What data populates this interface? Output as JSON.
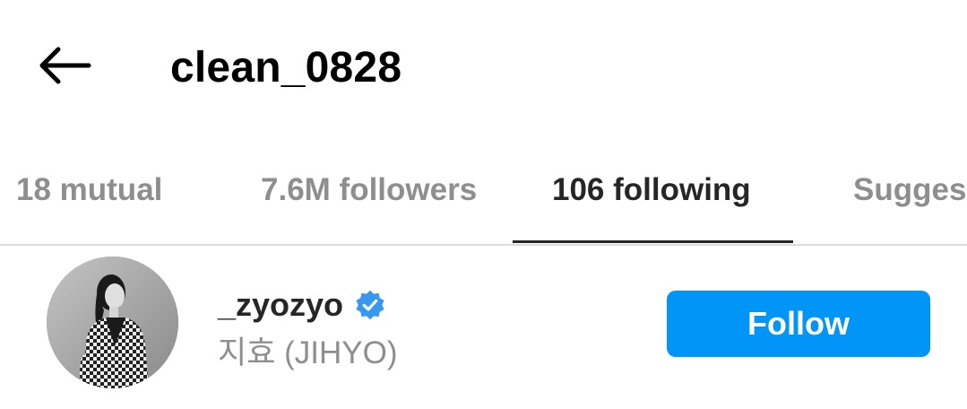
{
  "header": {
    "back_icon": "arrow-left-icon",
    "title": "clean_0828"
  },
  "tabs": [
    {
      "label": "18 mutual",
      "active": false
    },
    {
      "label": "7.6M followers",
      "active": false
    },
    {
      "label": "106 following",
      "active": true
    },
    {
      "label": "Suggested",
      "active": false
    }
  ],
  "list": [
    {
      "username": "_zyozyo",
      "verified": true,
      "verified_icon": "verified-badge-icon",
      "full_name": "지효 (JIHYO)",
      "avatar_icon": "profile-photo-avatar",
      "follow_label": "Follow"
    }
  ],
  "colors": {
    "accent": "#0095f6",
    "text_primary": "#262626",
    "text_secondary": "#8e8e8e",
    "divider": "#dbdbdb"
  }
}
